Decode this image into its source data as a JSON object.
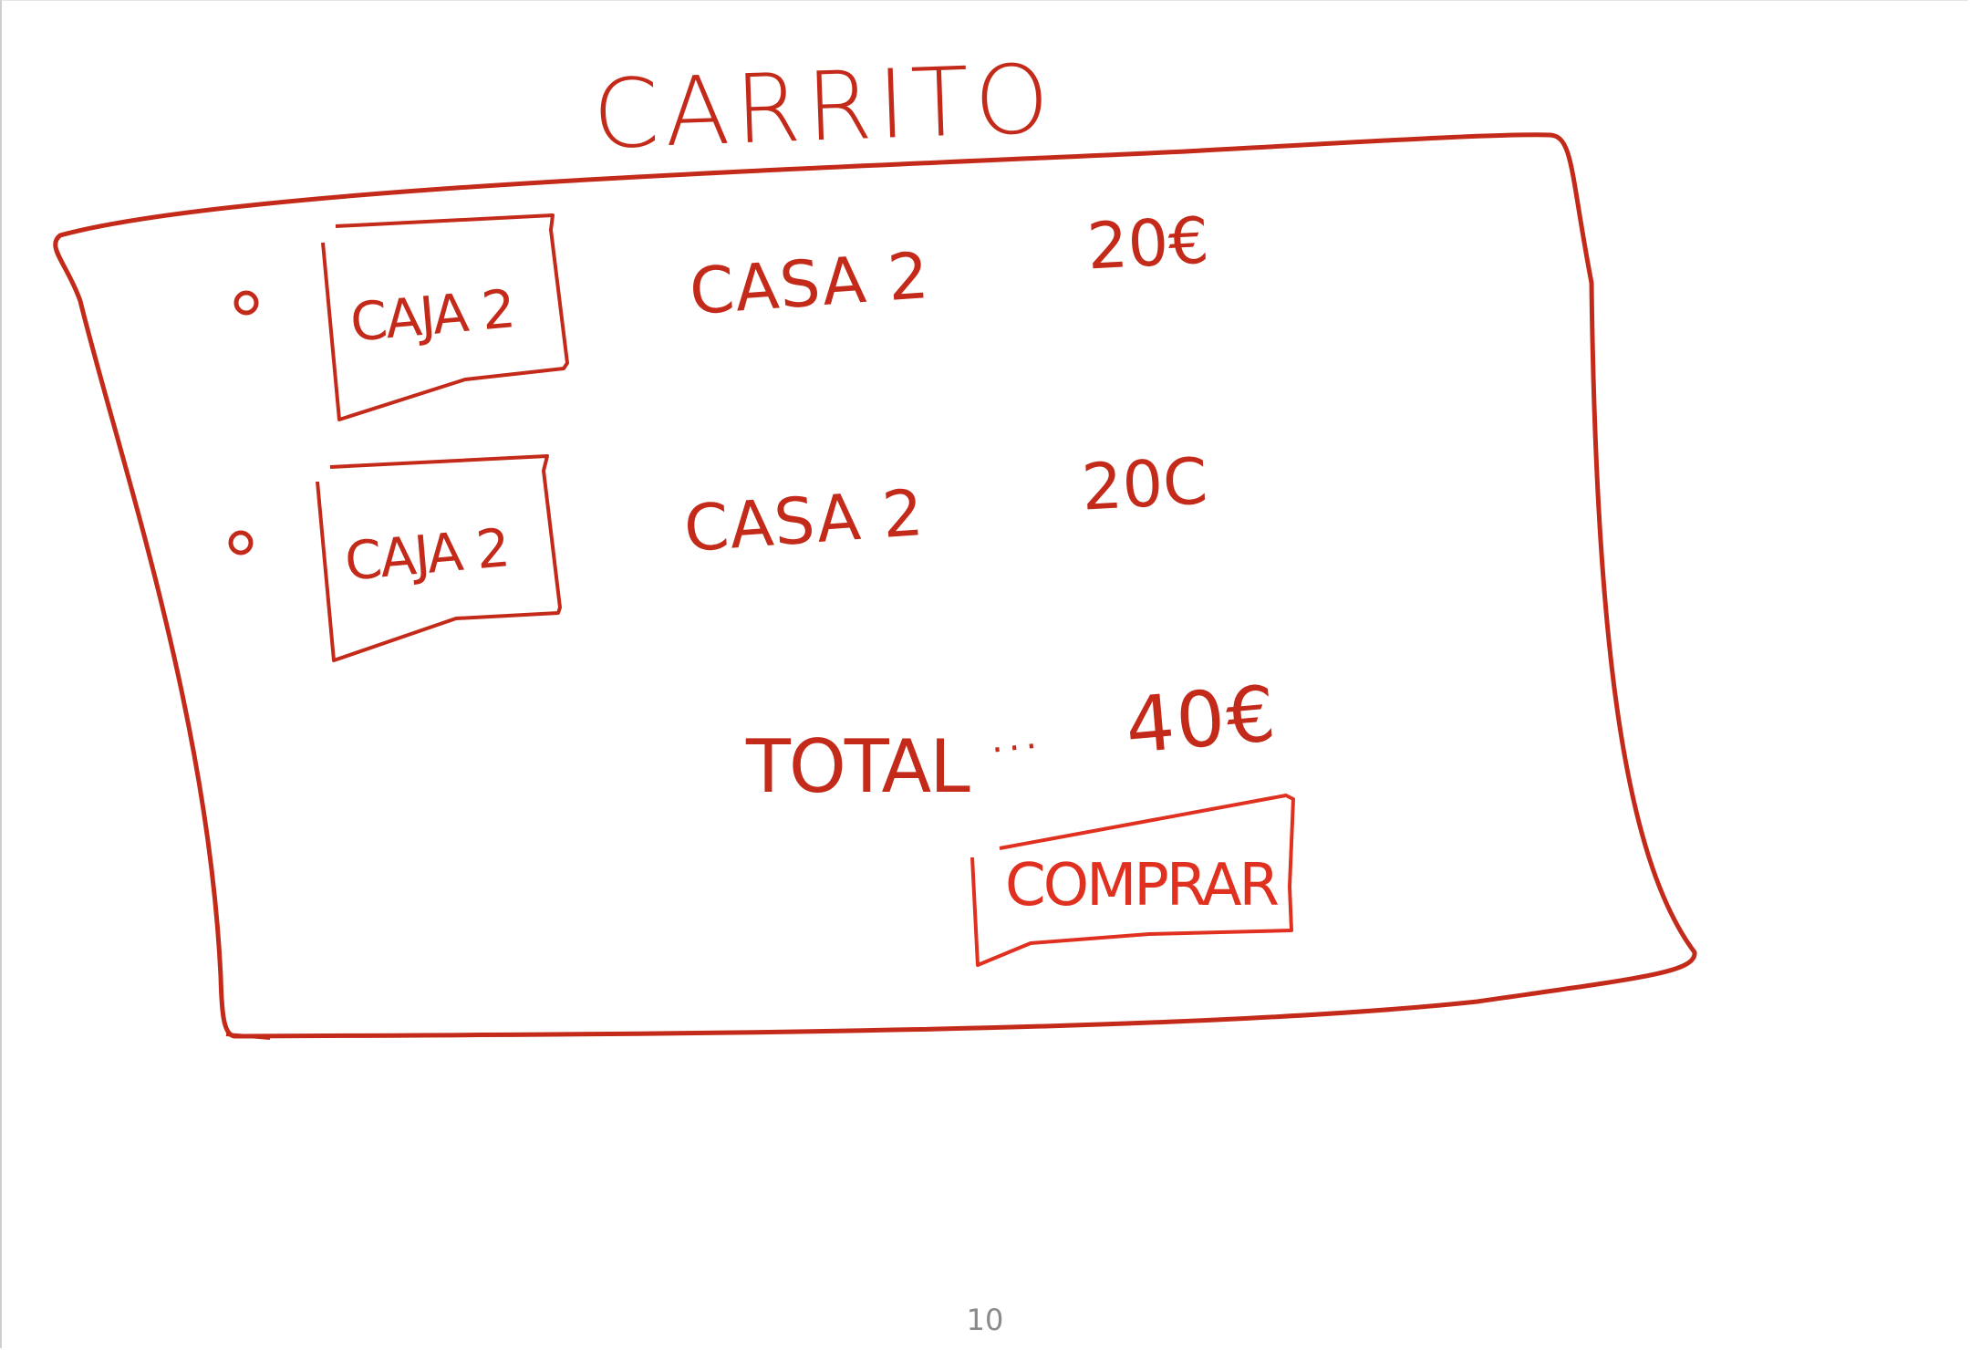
{
  "title": "CARRITO",
  "items": [
    {
      "thumbnail_label": "CAJA 2",
      "name": "CASA 2",
      "price": "20€"
    },
    {
      "thumbnail_label": "CAJA 2",
      "name": "CASA 2",
      "price": "20C"
    }
  ],
  "total": {
    "label": "TOTAL",
    "separator": "...",
    "value": "40€"
  },
  "buy_button_label": "COMPRAR",
  "page_number": "10",
  "colors": {
    "ink": "#c42a1a",
    "button_ink": "#e03020",
    "page_number": "#8a8a8a"
  }
}
